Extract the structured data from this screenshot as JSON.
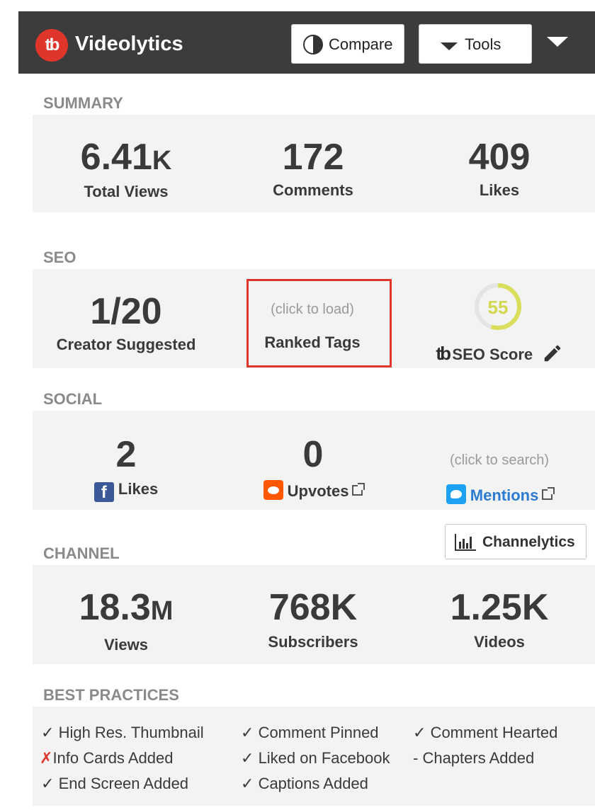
{
  "header": {
    "brand": "Videolytics",
    "logo_text": "tb",
    "compare_label": "Compare",
    "tools_label": "Tools"
  },
  "summary": {
    "title": "SUMMARY",
    "views_value": "6.41",
    "views_unit": "K",
    "views_label": "Total Views",
    "comments_value": "172",
    "comments_label": "Comments",
    "likes_value": "409",
    "likes_label": "Likes"
  },
  "seo": {
    "title": "SEO",
    "suggested_value": "1/20",
    "suggested_label": "Creator Suggested",
    "ranked_hint": "(click to load)",
    "ranked_label": "Ranked Tags",
    "score_value": "55",
    "score_fraction": 0.55,
    "score_logo_text": "tb",
    "score_label": "SEO Score"
  },
  "social": {
    "title": "SOCIAL",
    "fb_value": "2",
    "fb_label": "Likes",
    "reddit_value": "0",
    "reddit_label": "Upvotes",
    "twitter_hint": "(click to search)",
    "twitter_label": "Mentions"
  },
  "channel": {
    "title": "CHANNEL",
    "button_label": "Channelytics",
    "views_value": "18.3",
    "views_unit": "M",
    "views_label": "Views",
    "subs_value": "768K",
    "subs_label": "Subscribers",
    "videos_value": "1.25K",
    "videos_label": "Videos"
  },
  "best_practices": {
    "title": "BEST PRACTICES",
    "items": [
      {
        "mark": "✓",
        "label": "High Res. Thumbnail"
      },
      {
        "mark": "✓",
        "label": "Comment Pinned"
      },
      {
        "mark": "✓",
        "label": "Comment Hearted"
      },
      {
        "mark": "✗",
        "label": "Info Cards Added"
      },
      {
        "mark": "✓",
        "label": "Liked on Facebook"
      },
      {
        "mark": "-",
        "label": "Chapters Added"
      },
      {
        "mark": "✓",
        "label": "End Screen Added"
      },
      {
        "mark": "✓",
        "label": "Captions Added"
      }
    ]
  },
  "colors": {
    "header_bg": "#3c3c3c",
    "brand_red": "#e0352b",
    "panel_bg": "#f3f3f3",
    "score_yellow": "#d9df5a",
    "link_blue": "#2b7bd3"
  }
}
